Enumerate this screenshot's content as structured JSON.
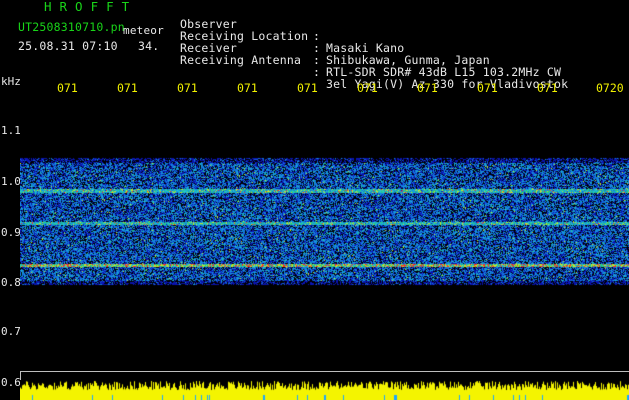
{
  "header": {
    "brand": "HROFFT",
    "filename": "UT2508310710.pn",
    "meteor_label": "meteor",
    "datetime": "25.08.31 07:10",
    "count": "34.",
    "info": [
      {
        "label": "Observer",
        "value": "Masaki Kano"
      },
      {
        "label": "Receiving Location",
        "value": "Shibukawa, Gunma, Japan"
      },
      {
        "label": "Receiver",
        "value": "RTL-SDR SDR# 43dB L15 103.2MHz CW"
      },
      {
        "label": "Receiving Antenna",
        "value": "3el Yagi(V) Az 330 for Vladivostok"
      }
    ]
  },
  "time_axis": {
    "ticks": [
      "071",
      "071",
      "071",
      "071",
      "071",
      "071",
      "071",
      "071",
      "071",
      "0720"
    ]
  },
  "freq_axis": {
    "unit": "kHz",
    "ticks": [
      "1.1",
      "1.0",
      "0.9",
      "0.8",
      "0.7",
      "0.6"
    ]
  },
  "spectrogram": {
    "freq_range_khz": [
      0.58,
      1.15
    ],
    "band_khz": [
      0.76,
      1.02
    ],
    "strong_lines_khz": [
      0.954,
      0.886,
      0.8
    ],
    "background_color": "#000000",
    "low_color": "#0a1a8c",
    "high_color": "#ff2020"
  },
  "signal_bar": {
    "color": "#f4f400",
    "accent_color": "#1aa7ff"
  }
}
